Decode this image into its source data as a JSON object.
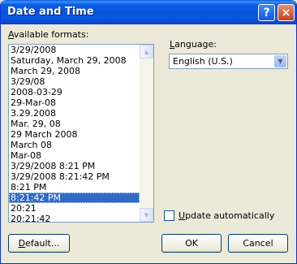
{
  "window": {
    "title": "Date and Time",
    "help_symbol": "?",
    "close_symbol": "×"
  },
  "formats": {
    "label_accel": "A",
    "label_rest": "vailable formats:",
    "items": [
      "3/29/2008",
      "Saturday, March 29, 2008",
      "March 29, 2008",
      "3/29/08",
      "2008-03-29",
      "29-Mar-08",
      "3.29.2008",
      "Mar. 29, 08",
      "29 March 2008",
      "March 08",
      "Mar-08",
      "3/29/2008 8:21 PM",
      "3/29/2008 8:21:42 PM",
      "8:21 PM",
      "8:21:42 PM",
      "20:21",
      "20:21:42"
    ],
    "selected_index": 14,
    "scroll_up_symbol": "▲",
    "scroll_down_symbol": "▼"
  },
  "language": {
    "label_accel": "L",
    "label_rest": "anguage:",
    "value": "English (U.S.)",
    "arrow_symbol": "▼"
  },
  "update": {
    "label_accel": "U",
    "label_rest": "pdate automatically",
    "checked": false
  },
  "buttons": {
    "default_accel": "D",
    "default_rest": "efault...",
    "ok": "OK",
    "cancel": "Cancel"
  }
}
